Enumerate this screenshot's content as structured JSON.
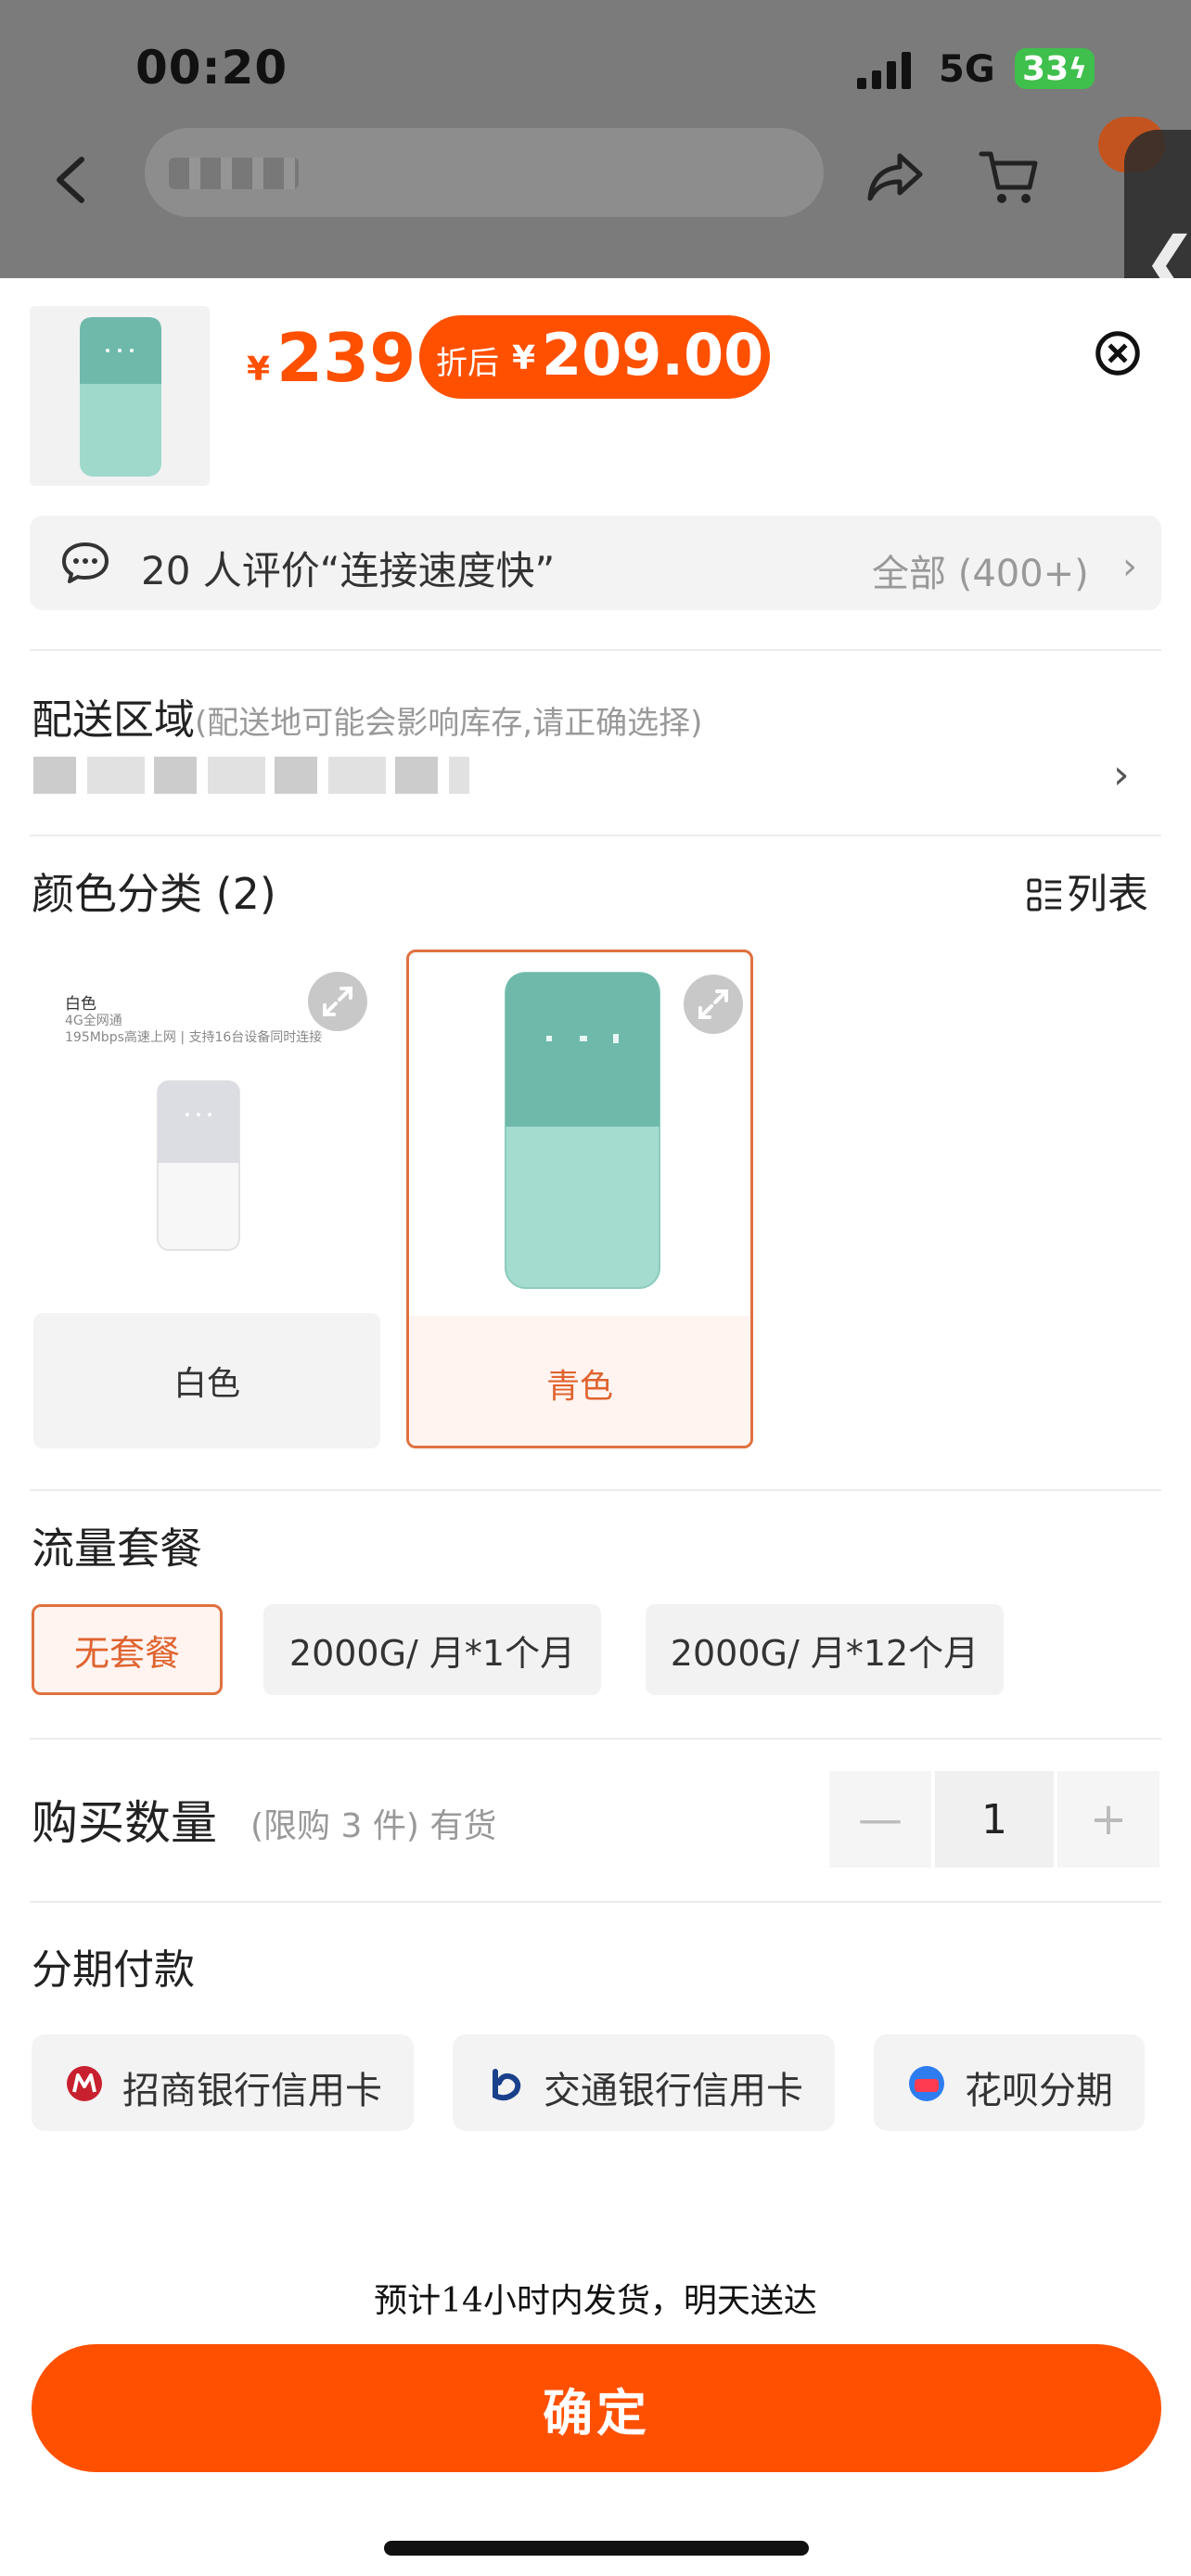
{
  "status": {
    "time": "00:20",
    "network": "5G",
    "battery": "33"
  },
  "header": {
    "nav_icons": [
      "back-icon",
      "share-icon",
      "cart-icon",
      "more-icon"
    ]
  },
  "product": {
    "price_symbol": "¥",
    "price": "239",
    "discount_label": "折后",
    "discount_symbol": "¥",
    "discount_price": "209.00"
  },
  "review": {
    "text": "20 人评价“连接速度快”",
    "all": "全部 (400+)"
  },
  "shipping": {
    "title": "配送区域",
    "note": "(配送地可能会影响库存,请正确选择)"
  },
  "color": {
    "title": "颜色分类 (2)",
    "list_label": "列表",
    "options": [
      {
        "label": "白色",
        "selected": false,
        "img_title": "白色",
        "img_line1": "4G全网通",
        "img_line2": "195Mbps高速上网 | 支持16台设备同时连接"
      },
      {
        "label": "青色",
        "selected": true
      }
    ]
  },
  "plan": {
    "title": "流量套餐",
    "options": [
      "无套餐",
      "2000G/ 月*1个月",
      "2000G/ 月*12个月"
    ],
    "selected_index": 0
  },
  "quantity": {
    "title": "购买数量",
    "note": "(限购 3 件) 有货",
    "value": "1",
    "minus": "—",
    "plus": "+"
  },
  "installment": {
    "title": "分期付款",
    "options": [
      "招商银行信用卡",
      "交通银行信用卡",
      "花呗分期"
    ]
  },
  "footer": {
    "eta": "预计14小时内发货，明天送达",
    "confirm": "确定"
  },
  "colors": {
    "accent": "#ff5000",
    "teal": "#6fb9ab",
    "teal_light": "#9fd9cc"
  }
}
